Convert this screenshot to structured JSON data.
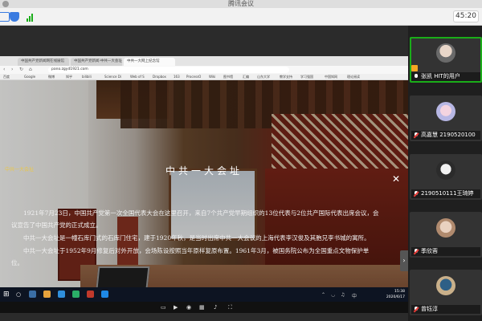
{
  "app": {
    "title": "腾讯会议",
    "timer": "45:20"
  },
  "browser": {
    "tabs": [
      "中国共产党新闻网在线展馆",
      "中国共产党新闻·中共一大会址",
      "中共一大网上纪念馆"
    ],
    "url": "pano.zgyd1921.com",
    "bookmarks": [
      "百度",
      "Google",
      "微博",
      "知乎",
      "bilibili",
      "Science Di",
      "Web of S",
      "Dropbox",
      "163",
      "ProcessO",
      "Wiki",
      "图书馆",
      "汇编",
      "山东大学",
      "教学支持",
      "学习强国",
      "中国知网",
      "理论阅读"
    ]
  },
  "pano": {
    "logo": "中共一大会址",
    "title": "中共一大会址",
    "intro": [
      "1921年7月23日，中国共产党第一次全国代表大会在这里召开，来自7个共产党早期组织的13位代表与2位共产国际代表出席会议，会议宣告了中国共产党的正式成立。",
      "中共一大会址是一幢石库门式的石库门住宅，建于1920年秋，是当时出席中共一大会议的上海代表李汉俊及其胞兄李书城的寓所。",
      "中共一大会址于1952年9月修复后对外开放，会场陈设按照当年原样复原布置。1961年3月，被国务院公布为全国重点文物保护单位。"
    ]
  },
  "taskbar": {
    "clock_time": "15:38",
    "clock_date": "2020/6/17",
    "ime": "中"
  },
  "participants": [
    {
      "name": "张凯 HIT的用户",
      "avatar": "avatar-photo",
      "muted": false,
      "host": true,
      "speaking": true
    },
    {
      "name": "高嘉慧 2190520100",
      "avatar": "avatar-anime",
      "muted": true,
      "host": false,
      "speaking": false
    },
    {
      "name": "2190510111王琦婷",
      "avatar": "avatar-anime-dark",
      "muted": true,
      "host": false,
      "speaking": false
    },
    {
      "name": "季欣蓉",
      "avatar": "avatar-anime-light",
      "muted": true,
      "host": false,
      "speaking": false
    },
    {
      "name": "曾钰淳",
      "avatar": "avatar-photo",
      "muted": true,
      "host": false,
      "speaking": false
    }
  ],
  "colors": {
    "accent": "#1aad19",
    "title_bar": "#dedede",
    "panel": "#1f1f1f",
    "taskbar": "#0d1422"
  }
}
